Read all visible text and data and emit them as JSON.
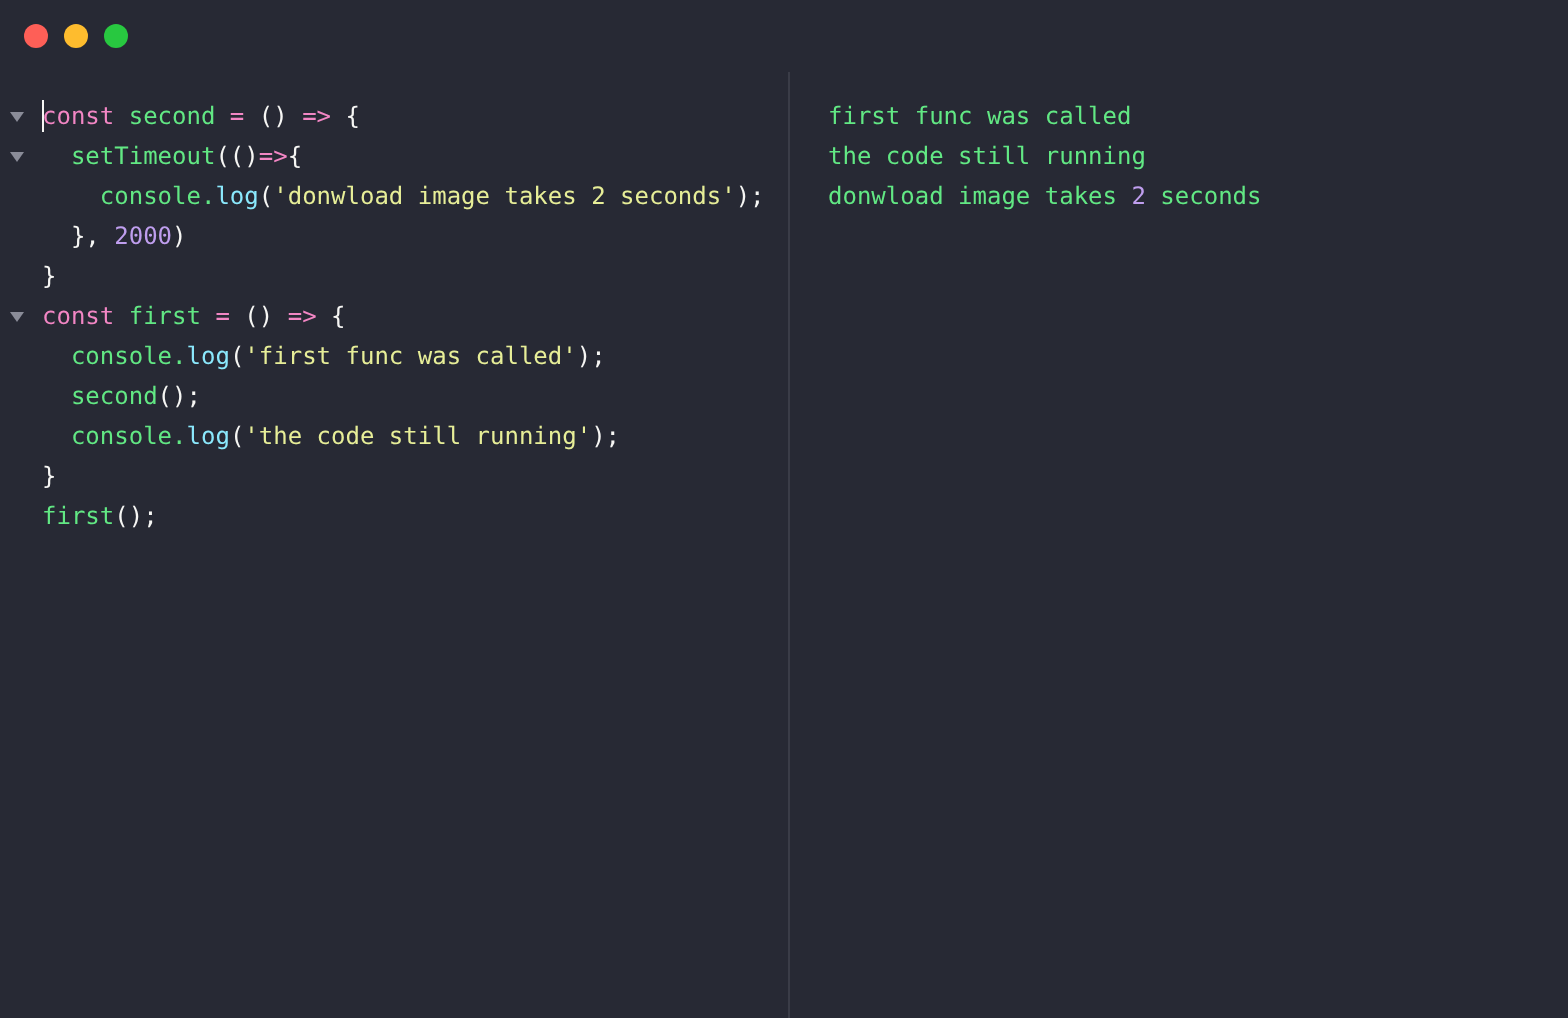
{
  "window": {
    "buttons": [
      {
        "kind": "close"
      },
      {
        "kind": "minimize"
      },
      {
        "kind": "zoom"
      }
    ]
  },
  "editor": {
    "lines": [
      {
        "foldable": true,
        "cursor": true,
        "tokens": [
          {
            "kind": "keyword",
            "text": "const"
          },
          {
            "kind": "name",
            "text": " second"
          },
          {
            "kind": "operator",
            "text": " ="
          },
          {
            "kind": "punct",
            "text": " ()"
          },
          {
            "kind": "operator",
            "text": " =>"
          },
          {
            "kind": "punct",
            "text": " {"
          }
        ]
      },
      {
        "foldable": true,
        "cursor": false,
        "tokens": [
          {
            "kind": "name",
            "text": "  setTimeout"
          },
          {
            "kind": "punct",
            "text": "(()"
          },
          {
            "kind": "operator",
            "text": "=>"
          },
          {
            "kind": "punct",
            "text": "{"
          }
        ]
      },
      {
        "foldable": false,
        "cursor": false,
        "tokens": [
          {
            "kind": "name",
            "text": "    console."
          },
          {
            "kind": "method",
            "text": "log"
          },
          {
            "kind": "punct",
            "text": "("
          },
          {
            "kind": "string",
            "text": "'donwload image takes 2 seconds'"
          },
          {
            "kind": "punct",
            "text": ");"
          }
        ]
      },
      {
        "foldable": false,
        "cursor": false,
        "tokens": [
          {
            "kind": "punct",
            "text": "  }, "
          },
          {
            "kind": "number",
            "text": "2000"
          },
          {
            "kind": "punct",
            "text": ")"
          }
        ]
      },
      {
        "foldable": false,
        "cursor": false,
        "tokens": [
          {
            "kind": "punct",
            "text": "}"
          }
        ]
      },
      {
        "foldable": true,
        "cursor": false,
        "tokens": [
          {
            "kind": "keyword",
            "text": "const"
          },
          {
            "kind": "name",
            "text": " first"
          },
          {
            "kind": "operator",
            "text": " ="
          },
          {
            "kind": "punct",
            "text": " ()"
          },
          {
            "kind": "operator",
            "text": " =>"
          },
          {
            "kind": "punct",
            "text": " {"
          }
        ]
      },
      {
        "foldable": false,
        "cursor": false,
        "tokens": [
          {
            "kind": "name",
            "text": "  console."
          },
          {
            "kind": "method",
            "text": "log"
          },
          {
            "kind": "punct",
            "text": "("
          },
          {
            "kind": "string",
            "text": "'first func was called'"
          },
          {
            "kind": "punct",
            "text": ");"
          }
        ]
      },
      {
        "foldable": false,
        "cursor": false,
        "tokens": [
          {
            "kind": "name",
            "text": "  second"
          },
          {
            "kind": "punct",
            "text": "();"
          }
        ]
      },
      {
        "foldable": false,
        "cursor": false,
        "tokens": [
          {
            "kind": "name",
            "text": "  console."
          },
          {
            "kind": "method",
            "text": "log"
          },
          {
            "kind": "punct",
            "text": "("
          },
          {
            "kind": "string",
            "text": "'the code still running'"
          },
          {
            "kind": "punct",
            "text": ");"
          }
        ]
      },
      {
        "foldable": false,
        "cursor": false,
        "tokens": [
          {
            "kind": "punct",
            "text": "}"
          }
        ]
      },
      {
        "foldable": false,
        "cursor": false,
        "tokens": [
          {
            "kind": "name",
            "text": "first"
          },
          {
            "kind": "punct",
            "text": "();"
          }
        ]
      }
    ]
  },
  "output": {
    "lines": [
      {
        "tokens": [
          {
            "kind": "text",
            "text": "first func was called"
          }
        ]
      },
      {
        "tokens": [
          {
            "kind": "text",
            "text": "the code still running"
          }
        ]
      },
      {
        "tokens": [
          {
            "kind": "text",
            "text": "donwload image takes "
          },
          {
            "kind": "number",
            "text": "2"
          },
          {
            "kind": "text",
            "text": " seconds"
          }
        ]
      }
    ]
  }
}
